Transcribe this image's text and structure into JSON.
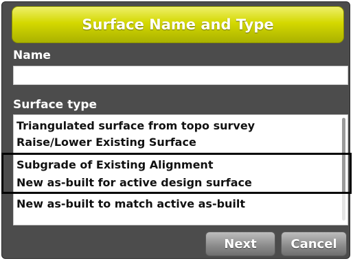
{
  "dialog": {
    "title": "Surface Name and Type",
    "name_label": "Name",
    "name_value": "",
    "surface_type_label": "Surface type",
    "surface_types": [
      "Triangulated surface from topo survey",
      "Raise/Lower Existing Surface",
      "Subgrade of Existing Alignment",
      "New as-built for active design surface",
      "New as-built to match active as-built"
    ],
    "next_label": "Next",
    "cancel_label": "Cancel"
  }
}
